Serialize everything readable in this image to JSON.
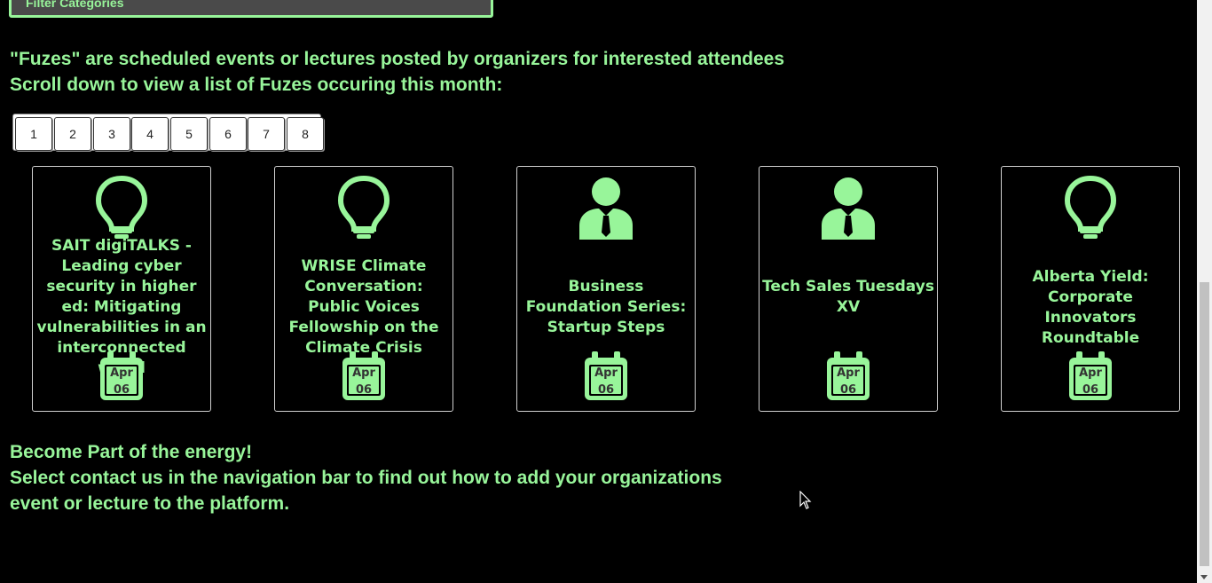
{
  "filter": {
    "label": "Filter Categories"
  },
  "intro": {
    "line1": "\"Fuzes\" are scheduled events or lectures posted by organizers for interested attendees",
    "line2": "Scroll down to view a list of Fuzes occuring this month:"
  },
  "pagination": {
    "pages": [
      "1",
      "2",
      "3",
      "4",
      "5",
      "6",
      "7",
      "8"
    ]
  },
  "events": [
    {
      "icon": "lightbulb-icon",
      "title": "SAIT digiTALKS - Leading cyber security in higher ed: Mitigating vulnerabilities in an interconnected world",
      "month": "Apr",
      "day": "06"
    },
    {
      "icon": "lightbulb-icon",
      "title": "WRISE Climate Conversation: Public Voices Fellowship on the Climate Crisis",
      "month": "Apr",
      "day": "06"
    },
    {
      "icon": "businessperson-icon",
      "title": "Business Foundation Series: Startup Steps",
      "month": "Apr",
      "day": "06"
    },
    {
      "icon": "businessperson-icon",
      "title": "Tech Sales Tuesdays XV",
      "month": "Apr",
      "day": "06"
    },
    {
      "icon": "lightbulb-icon",
      "title": "Alberta Yield: Corporate Innovators Roundtable",
      "month": "Apr",
      "day": "06"
    }
  ],
  "outro": {
    "line1": "Become Part of the energy!",
    "line2": "Select contact us in the navigation bar to find out how to add your organizations",
    "line3": "event or lecture to the platform."
  },
  "colors": {
    "accent": "#98f59a",
    "background": "#000000",
    "card_border": "#d0d0d0"
  }
}
